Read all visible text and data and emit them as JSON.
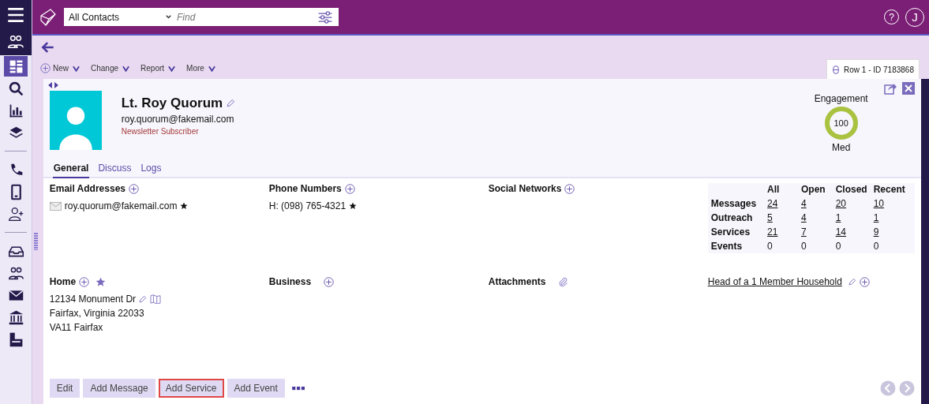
{
  "top_bar": {
    "view_select": "All Contacts",
    "search": {
      "placeholder": "Find"
    },
    "help_label": "?",
    "user_initial": "J"
  },
  "sidebar": {
    "groups": [
      [
        {
          "kind": "dashboard",
          "selected": true
        },
        {
          "kind": "search",
          "selected": false
        },
        {
          "kind": "chart",
          "selected": false
        },
        {
          "kind": "layers",
          "selected": false
        }
      ],
      [
        {
          "kind": "phone",
          "selected": false
        },
        {
          "kind": "mobile",
          "selected": false
        },
        {
          "kind": "person-add",
          "selected": false
        }
      ],
      [
        {
          "kind": "inbox",
          "selected": false
        },
        {
          "kind": "people",
          "selected": false
        },
        {
          "kind": "mail",
          "selected": false
        },
        {
          "kind": "bank",
          "selected": false
        },
        {
          "kind": "document",
          "selected": false
        }
      ]
    ]
  },
  "toolbar": {
    "menus": [
      {
        "label": "New",
        "kind": "add"
      },
      {
        "label": "Change",
        "kind": "menu"
      },
      {
        "label": "Report",
        "kind": "menu"
      },
      {
        "label": "More",
        "kind": "menu"
      }
    ],
    "record_tab": "Row 1 - ID 7183868"
  },
  "contact": {
    "name": "Lt. Roy Quorum",
    "email": "roy.quorum@fakemail.com",
    "tag": "Newsletter Subscriber"
  },
  "engagement": {
    "label": "Engagement",
    "value": "100",
    "level": 1,
    "rating": "Med"
  },
  "tabs": [
    {
      "label": "General",
      "selected": true
    },
    {
      "label": "Discuss",
      "selected": false
    },
    {
      "label": "Logs",
      "selected": false
    }
  ],
  "email_addresses": {
    "title": "Email Addresses",
    "items": [
      {
        "value": "roy.quorum@fakemail.com",
        "primary": true
      }
    ]
  },
  "phone_numbers": {
    "title": "Phone Numbers",
    "items": [
      {
        "value": "H: (098) 765-4321",
        "primary": true
      }
    ]
  },
  "social_networks": {
    "title": "Social Networks"
  },
  "activity_stats": {
    "columns": [
      "All",
      "Open",
      "Closed",
      "Recent"
    ],
    "rows": [
      {
        "label": "Messages",
        "values": [
          "24",
          "4",
          "20",
          "10"
        ],
        "linked": true
      },
      {
        "label": "Outreach",
        "values": [
          "5",
          "4",
          "1",
          "1"
        ],
        "linked": true
      },
      {
        "label": "Services",
        "values": [
          "21",
          "7",
          "14",
          "9"
        ],
        "linked": true
      },
      {
        "label": "Events",
        "values": [
          "0",
          "0",
          "0",
          "0"
        ],
        "linked": false
      }
    ]
  },
  "home_address": {
    "title": "Home",
    "primary": true,
    "lines": [
      "12134 Monument Dr",
      "Fairfax, Virginia 22033",
      "VA11 Fairfax"
    ]
  },
  "business_address": {
    "title": "Business"
  },
  "attachments": {
    "title": "Attachments"
  },
  "household": {
    "label": "Head of a 1 Member Household"
  },
  "actions": [
    {
      "label": "Edit",
      "highlighted": false
    },
    {
      "label": "Add Message",
      "highlighted": false
    },
    {
      "label": "Add Service",
      "highlighted": true
    },
    {
      "label": "Add Event",
      "highlighted": false
    }
  ],
  "pager": {
    "previous_disabled": true,
    "next_disabled": true
  }
}
